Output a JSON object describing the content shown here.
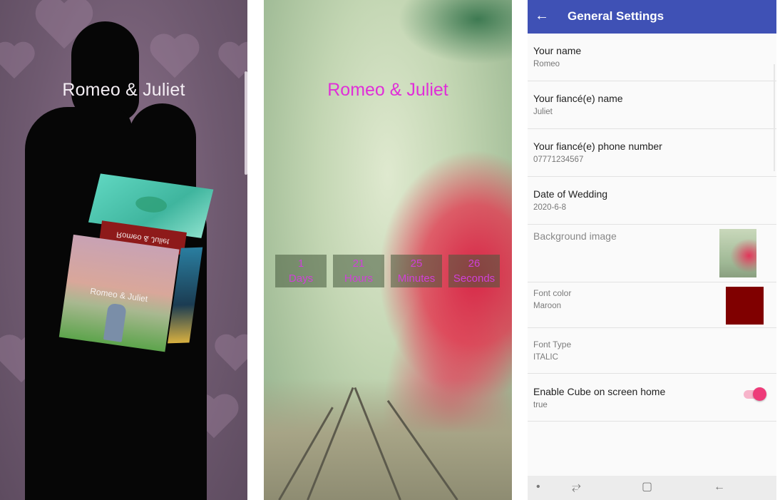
{
  "panel_left": {
    "title": "Romeo & Juliet",
    "cube": {
      "band_text": "Romeo & Juliet",
      "front_text": "Romeo & Juliet"
    }
  },
  "panel_middle": {
    "title": "Romeo & Juliet",
    "title_color": "#e02fd8",
    "countdown": [
      {
        "value": "1",
        "unit": "Days"
      },
      {
        "value": "21",
        "unit": "Hours"
      },
      {
        "value": "25",
        "unit": "Minutes"
      },
      {
        "value": "26",
        "unit": "Seconds"
      }
    ]
  },
  "panel_right": {
    "appbar": {
      "back_icon": "←",
      "title": "General Settings",
      "color": "#3f51b5"
    },
    "preferences": [
      {
        "title": "Your name",
        "summary": "Romeo"
      },
      {
        "title": "Your fiancé(e) name",
        "summary": "Juliet"
      },
      {
        "title": "Your fiancé(e) phone number",
        "summary": "07771234567"
      },
      {
        "title": "Date of Wedding",
        "summary": "2020-6-8"
      },
      {
        "title": "Background image",
        "summary": ""
      },
      {
        "title": "Font color",
        "summary": "Maroon",
        "swatch": "#800000"
      },
      {
        "title": "Font Type",
        "summary": "ITALIC"
      },
      {
        "title": "Enable Cube on screen home",
        "summary": "true",
        "toggle_on": true
      }
    ],
    "navbar": {
      "dot": "•",
      "recents_icon": "⥂",
      "home_icon": "▢",
      "back_icon": "←"
    }
  }
}
